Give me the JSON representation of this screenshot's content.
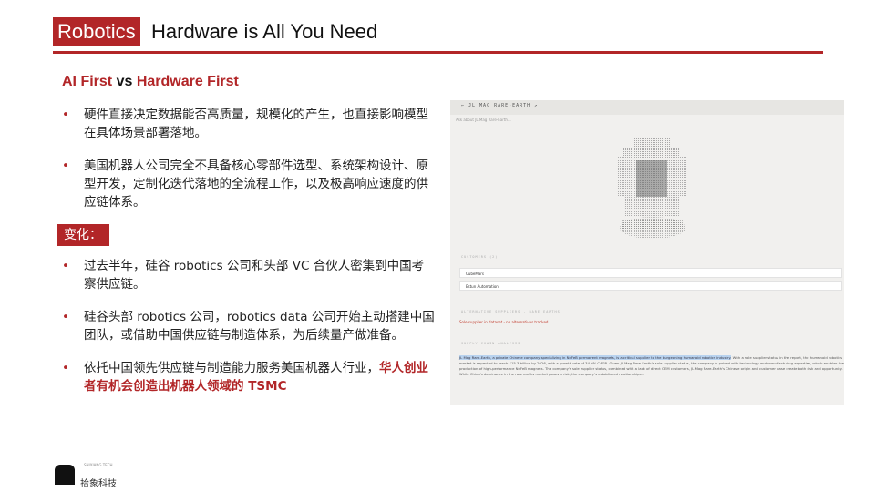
{
  "header": {
    "tag": "Robotics",
    "title": "Hardware is All You Need"
  },
  "subtitle": {
    "part1": "AI First",
    "vs": " vs ",
    "part2": "Hardware First"
  },
  "bullets_top": [
    "硬件直接决定数据能否高质量，规模化的产生，也直接影响模型在具体场景部署落地。",
    "美国机器人公司完全不具备核心零部件选型、系统架构设计、原型开发，定制化迭代落地的全流程工作，以及极高响应速度的供应链体系。"
  ],
  "change_label": "变化：",
  "bullets_bottom": [
    "过去半年，硅谷 robotics 公司和头部 VC 合伙人密集到中国考察供应链。",
    "硅谷头部 robotics 公司，robotics data 公司开始主动搭建中国团队，或借助中国供应链与制造体系，为后续量产做准备。"
  ],
  "bullet_last": {
    "normal": "依托中国领先供应链与制造能力服务美国机器人行业，",
    "highlight": "华人创业者有机会创造出机器人领域的 TSMC"
  },
  "footer": {
    "logo_tiny": "SHIXIANG TECH",
    "logo_text": "拾象科技"
  },
  "screenshot": {
    "title": "←  JL MAG RARE-EARTH  ↗",
    "ask": "Ask about JL Mag Rare-Earth...",
    "customers_label": "CUSTOMERS (2)",
    "customers": [
      "CubeMars",
      "Estun Automation"
    ],
    "alt_label": "ALTERNATIVE SUPPLIERS - RARE EARTHS",
    "alt_text": "Sole supplier in dataset - no alternatives tracked",
    "risk_label": "SUPPLY CHAIN ANALYSIS",
    "para_hl": "JL Mag Rare-Earth, a private Chinese company specializing in NdFeB permanent magnets, is a critical supplier to the burgeoning humanoid robotics industry.",
    "para_rest": " With a sole supplier status in the report, the humanoid robotics market is expected to reach $15.3 billion by 2026, with a growth rate of 34.6% CAGR. Given JL Mag Rare-Earth's sole supplier status, the company is poised with technology and manufacturing expertise, which enables the production of high-performance NdFeB magnets. The company's sole supplier status, combined with a lack of direct OEM customers, JL Mag Rare-Earth's Chinese origin and customer base create both risk and opportunity. While China's dominance in the rare earths market poses a risk, the company's established relationships..."
  },
  "colors": {
    "accent": "#b22628"
  }
}
